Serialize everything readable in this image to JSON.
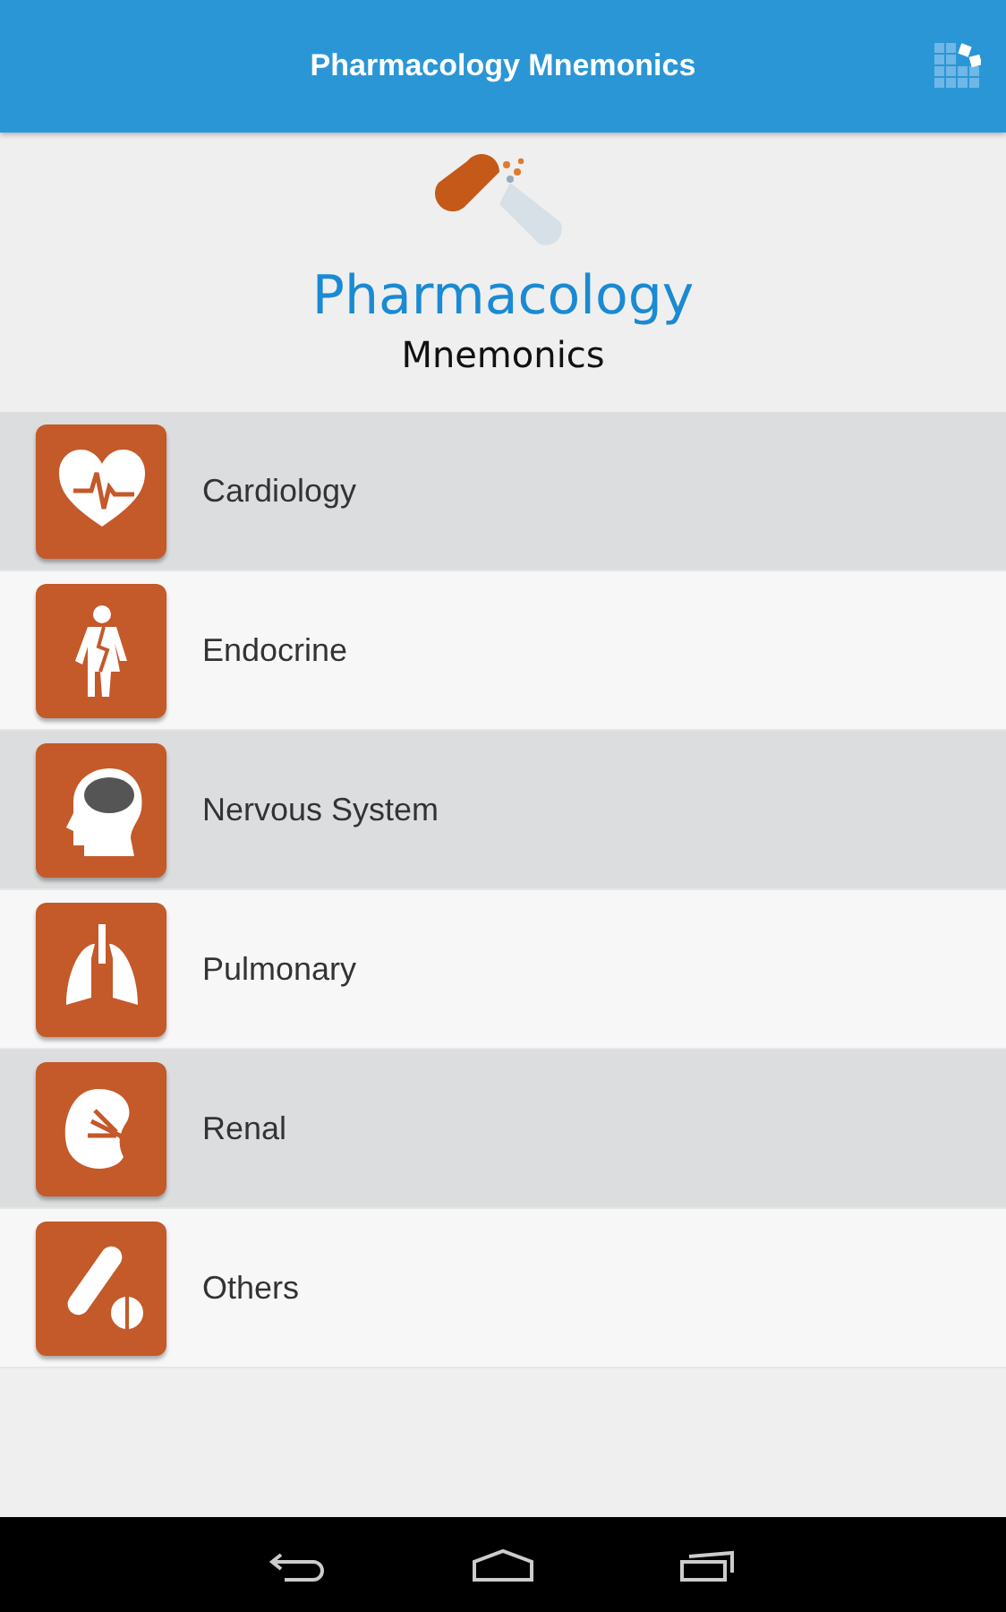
{
  "app_bar": {
    "title": "Pharmacology Mnemonics"
  },
  "logo": {
    "title": "Pharmacology",
    "subtitle": "Mnemonics"
  },
  "categories": [
    {
      "kind": "heart",
      "label": "Cardiology"
    },
    {
      "kind": "body",
      "label": "Endocrine"
    },
    {
      "kind": "head",
      "label": "Nervous System"
    },
    {
      "kind": "lungs",
      "label": "Pulmonary"
    },
    {
      "kind": "kidney",
      "label": "Renal"
    },
    {
      "kind": "pills",
      "label": "Others"
    }
  ]
}
